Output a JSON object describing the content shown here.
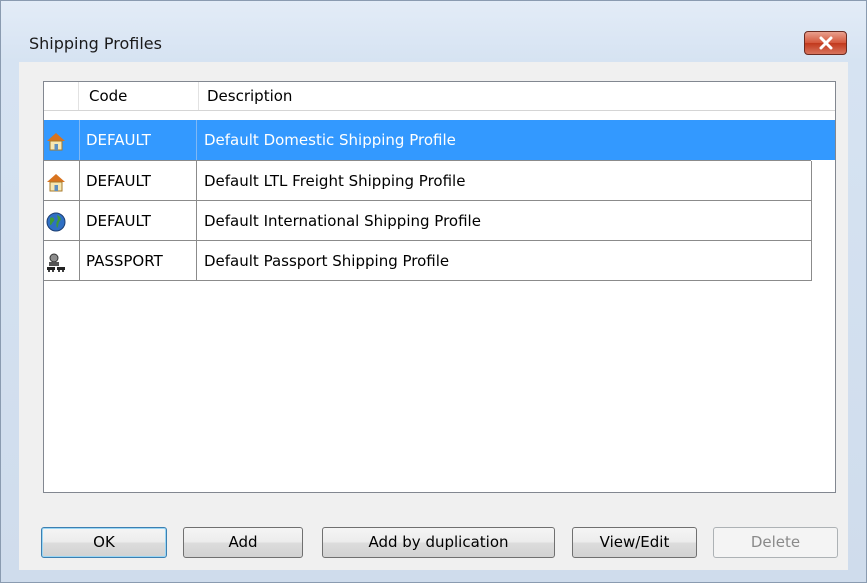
{
  "window": {
    "title": "Shipping Profiles",
    "close_icon": "close-icon"
  },
  "list": {
    "columns": [
      "Code",
      "Description"
    ],
    "rows": [
      {
        "icon": "house-icon",
        "code": "DEFAULT",
        "description": "Default Domestic Shipping Profile",
        "selected": true
      },
      {
        "icon": "house-icon",
        "code": "DEFAULT",
        "description": "Default LTL Freight Shipping Profile",
        "selected": false
      },
      {
        "icon": "globe-icon",
        "code": "DEFAULT",
        "description": "Default International Shipping Profile",
        "selected": false
      },
      {
        "icon": "passport-icon",
        "code": "PASSPORT",
        "description": "Default Passport Shipping Profile",
        "selected": false
      }
    ]
  },
  "buttons": {
    "ok": "OK",
    "add": "Add",
    "add_dup": "Add by duplication",
    "view_edit": "View/Edit",
    "delete": "Delete"
  },
  "colors": {
    "selection": "#3399ff",
    "close": "#c2391d"
  }
}
